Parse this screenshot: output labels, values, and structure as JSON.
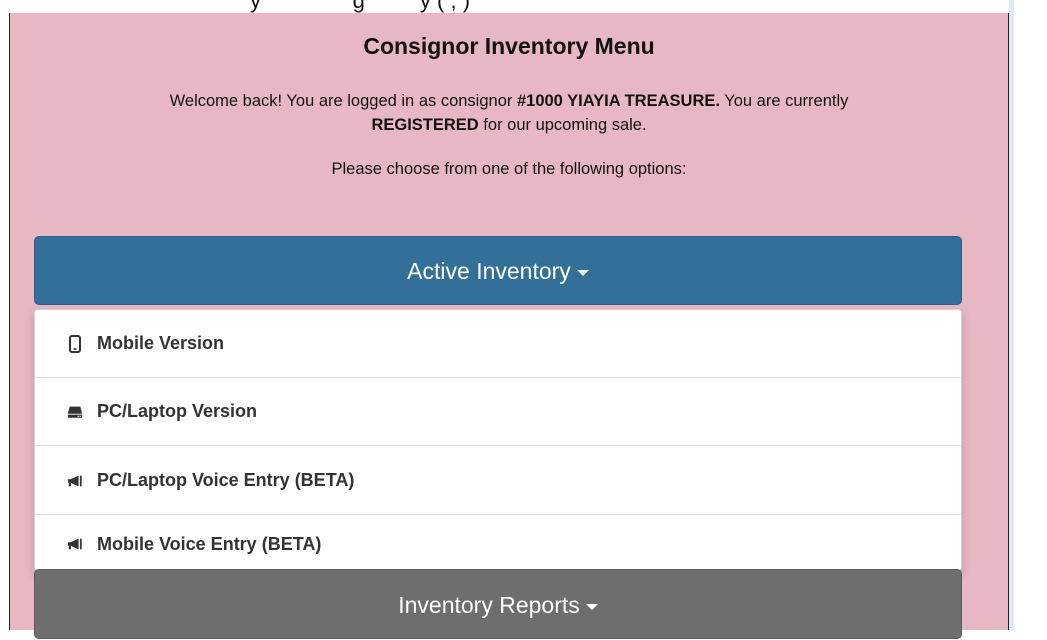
{
  "page": {
    "top_cut_text": "y                       g             y  (  ,  )",
    "title": "Consignor Inventory Menu",
    "welcome_prefix": "Welcome back! You are logged in as consignor ",
    "consignor_name": "#1000 YIAYIA TREASURE.",
    "welcome_middle": " You are currently ",
    "registration_status": "REGISTERED",
    "welcome_suffix": " for our upcoming sale.",
    "choose_prompt": "Please choose from one of the following options:"
  },
  "menu": {
    "active_inventory_label": "Active Inventory",
    "inventory_reports_label": "Inventory Reports",
    "dropdown_items": [
      {
        "label": "Mobile Version",
        "icon": "mobile-phone-icon"
      },
      {
        "label": "PC/Laptop Version",
        "icon": "laptop-icon"
      },
      {
        "label": "PC/Laptop Voice Entry (BETA)",
        "icon": "bullhorn-icon"
      },
      {
        "label": "Mobile Voice Entry (BETA)",
        "icon": "bullhorn-icon"
      }
    ]
  },
  "colors": {
    "panel_bg": "#e7b8c4",
    "active_button": "#337099",
    "reports_button": "#6e6e6e"
  }
}
